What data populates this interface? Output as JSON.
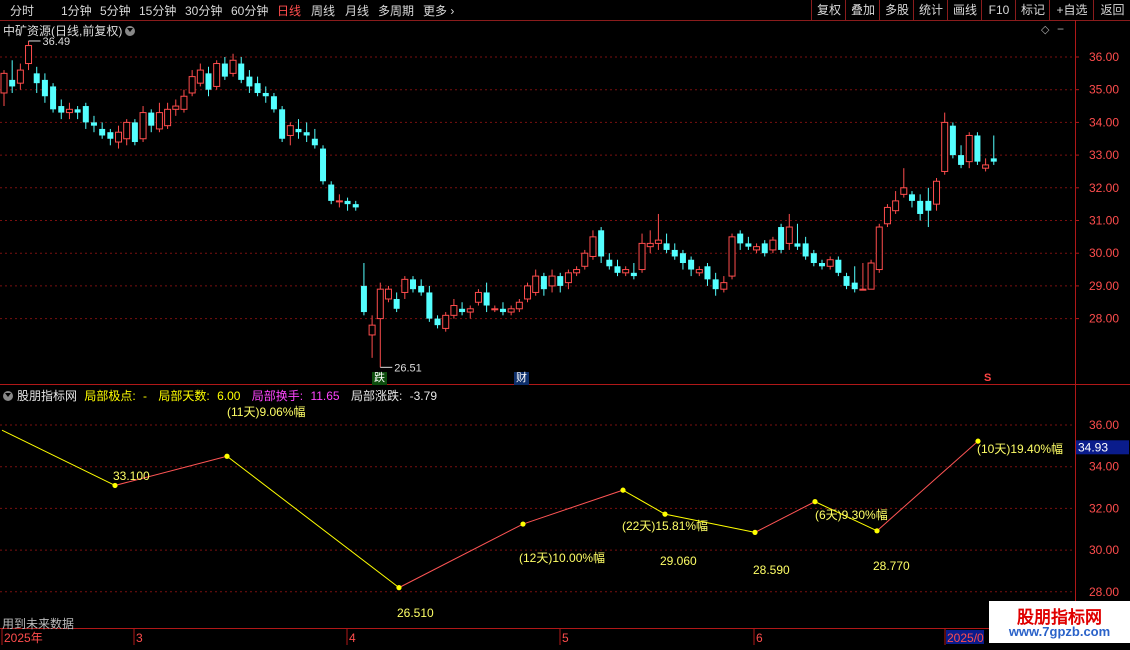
{
  "toolbar": {
    "timeframes": [
      "分时",
      "1分钟",
      "5分钟",
      "15分钟",
      "30分钟",
      "60分钟",
      "日线",
      "周线",
      "月线",
      "多周期",
      "更多"
    ],
    "active_index": 6,
    "buttons": [
      "复权",
      "叠加",
      "多股",
      "统计",
      "画线",
      "F10",
      "标记",
      "+自选",
      "返回"
    ]
  },
  "chart_title": "中矿资源(日线,前复权)",
  "colors": {
    "up": "#ff4d4d",
    "down": "#54ffff",
    "line": "#ffff00",
    "grid": "#7a1010",
    "axis": "#b01818"
  },
  "main_axis_labels": [
    "36.00",
    "35.00",
    "34.00",
    "33.00",
    "32.00",
    "31.00",
    "30.00",
    "29.00",
    "28.00"
  ],
  "high_label": "36.49",
  "low_label": "26.51",
  "event_marks": [
    "跌",
    "财",
    "S"
  ],
  "indicator": {
    "name": "股朋指标网",
    "items": [
      {
        "label": "局部极点:",
        "value": "-",
        "color": "#ffff00"
      },
      {
        "label": "局部天数:",
        "value": "6.00",
        "color": "#ffff00"
      },
      {
        "label": "局部换手:",
        "value": "11.65",
        "color": "#ff44ff"
      },
      {
        "label": "局部涨跌:",
        "value": "-3.79",
        "color": "#e6e6e6"
      }
    ],
    "axis_labels": [
      "36.00",
      "34.00",
      "32.00",
      "30.00",
      "28.00"
    ],
    "current_value": "34.93",
    "labels": [
      "33.100",
      "(11天)9.06%幅",
      "26.510",
      "(12天)10.00%幅",
      "(22天)15.81%幅",
      "29.060",
      "28.590",
      "(6天)9.30%幅",
      "28.770",
      "(10天)19.40%幅"
    ]
  },
  "footer_text": "用到未来数据",
  "date_axis": [
    "2025年",
    "3",
    "4",
    "5",
    "6",
    "2025/0"
  ],
  "watermark": {
    "line1": "股朋指标网",
    "line2": "www.7gpzb.com"
  },
  "candles": [
    [
      34.9,
      35.5,
      35.6,
      34.5
    ],
    [
      35.3,
      35.1,
      35.9,
      34.9
    ],
    [
      35.2,
      35.6,
      35.8,
      35.0
    ],
    [
      35.8,
      36.35,
      36.49,
      35.6
    ],
    [
      35.5,
      35.2,
      35.7,
      34.9
    ],
    [
      35.3,
      34.8,
      35.5,
      34.6
    ],
    [
      35.1,
      34.4,
      35.2,
      34.3
    ],
    [
      34.5,
      34.3,
      34.7,
      34.1
    ],
    [
      34.3,
      34.4,
      34.6,
      34.1
    ],
    [
      34.4,
      34.3,
      34.5,
      34.1
    ],
    [
      34.5,
      34.0,
      34.6,
      33.8
    ],
    [
      34.0,
      33.9,
      34.2,
      33.7
    ],
    [
      33.8,
      33.6,
      34.0,
      33.5
    ],
    [
      33.7,
      33.5,
      33.8,
      33.3
    ],
    [
      33.4,
      33.7,
      33.9,
      33.2
    ],
    [
      33.5,
      34.0,
      34.1,
      33.3
    ],
    [
      34.0,
      33.4,
      34.1,
      33.3
    ],
    [
      33.5,
      34.3,
      34.5,
      33.4
    ],
    [
      34.3,
      33.9,
      34.4,
      33.7
    ],
    [
      33.8,
      34.3,
      34.6,
      33.7
    ],
    [
      33.9,
      34.4,
      34.6,
      33.8
    ],
    [
      34.4,
      34.5,
      34.7,
      34.2
    ],
    [
      34.4,
      34.8,
      35.0,
      34.3
    ],
    [
      34.9,
      35.4,
      35.6,
      34.8
    ],
    [
      35.2,
      35.6,
      35.8,
      35.1
    ],
    [
      35.5,
      35.0,
      35.7,
      34.8
    ],
    [
      35.1,
      35.8,
      35.9,
      35.0
    ],
    [
      35.8,
      35.4,
      36.0,
      35.3
    ],
    [
      35.5,
      35.9,
      36.1,
      35.4
    ],
    [
      35.8,
      35.3,
      36.0,
      35.2
    ],
    [
      35.4,
      35.1,
      35.6,
      34.9
    ],
    [
      35.2,
      34.9,
      35.4,
      34.8
    ],
    [
      34.9,
      34.8,
      35.1,
      34.6
    ],
    [
      34.8,
      34.4,
      34.9,
      34.3
    ],
    [
      34.4,
      33.5,
      34.5,
      33.4
    ],
    [
      33.6,
      33.9,
      34.0,
      33.3
    ],
    [
      33.8,
      33.7,
      34.1,
      33.5
    ],
    [
      33.7,
      33.6,
      34.0,
      33.4
    ],
    [
      33.5,
      33.3,
      33.8,
      33.2
    ],
    [
      33.2,
      32.2,
      33.3,
      32.1
    ],
    [
      32.1,
      31.6,
      32.2,
      31.5
    ],
    [
      31.6,
      31.6,
      31.8,
      31.4
    ],
    [
      31.6,
      31.5,
      31.7,
      31.3
    ],
    [
      31.5,
      31.4,
      31.6,
      31.3
    ],
    [
      29.0,
      28.2,
      29.7,
      28.1
    ],
    [
      27.5,
      27.8,
      28.1,
      26.8
    ],
    [
      28.0,
      28.9,
      29.1,
      26.51
    ],
    [
      28.6,
      28.9,
      29.0,
      28.5
    ],
    [
      28.6,
      28.3,
      28.8,
      28.2
    ],
    [
      28.8,
      29.2,
      29.3,
      28.6
    ],
    [
      29.2,
      28.9,
      29.3,
      28.8
    ],
    [
      29.0,
      28.8,
      29.2,
      28.7
    ],
    [
      28.8,
      28.0,
      29.0,
      27.9
    ],
    [
      28.0,
      27.8,
      28.1,
      27.7
    ],
    [
      27.7,
      28.1,
      28.2,
      27.6
    ],
    [
      28.1,
      28.4,
      28.6,
      28.0
    ],
    [
      28.3,
      28.2,
      28.5,
      28.1
    ],
    [
      28.2,
      28.3,
      28.4,
      28.0
    ],
    [
      28.5,
      28.8,
      28.9,
      28.4
    ],
    [
      28.8,
      28.4,
      29.1,
      28.2
    ],
    [
      28.3,
      28.3,
      28.4,
      28.2
    ],
    [
      28.3,
      28.2,
      28.5,
      28.1
    ],
    [
      28.2,
      28.3,
      28.4,
      28.1
    ],
    [
      28.3,
      28.5,
      28.6,
      28.2
    ],
    [
      28.6,
      29.0,
      29.1,
      28.5
    ],
    [
      28.8,
      29.3,
      29.5,
      28.7
    ],
    [
      29.3,
      28.9,
      29.4,
      28.7
    ],
    [
      29.0,
      29.3,
      29.5,
      28.8
    ],
    [
      29.3,
      29.0,
      29.4,
      28.8
    ],
    [
      29.1,
      29.4,
      29.5,
      28.9
    ],
    [
      29.4,
      29.5,
      29.6,
      29.3
    ],
    [
      29.6,
      30.0,
      30.1,
      29.5
    ],
    [
      29.9,
      30.5,
      30.7,
      29.8
    ],
    [
      30.7,
      29.9,
      30.8,
      29.7
    ],
    [
      29.8,
      29.6,
      30.0,
      29.5
    ],
    [
      29.6,
      29.4,
      29.8,
      29.3
    ],
    [
      29.4,
      29.5,
      29.6,
      29.3
    ],
    [
      29.4,
      29.3,
      29.7,
      29.2
    ],
    [
      29.5,
      30.3,
      30.6,
      29.4
    ],
    [
      30.2,
      30.3,
      30.7,
      30.0
    ],
    [
      30.3,
      30.4,
      31.2,
      30.1
    ],
    [
      30.3,
      30.1,
      30.6,
      30.0
    ],
    [
      30.1,
      29.9,
      30.3,
      29.8
    ],
    [
      30.0,
      29.7,
      30.1,
      29.5
    ],
    [
      29.8,
      29.5,
      29.9,
      29.3
    ],
    [
      29.4,
      29.5,
      29.6,
      29.3
    ],
    [
      29.6,
      29.2,
      29.7,
      29.0
    ],
    [
      29.2,
      28.9,
      29.4,
      28.7
    ],
    [
      28.9,
      29.1,
      29.3,
      28.8
    ],
    [
      29.3,
      30.5,
      30.6,
      29.2
    ],
    [
      30.6,
      30.3,
      30.7,
      30.1
    ],
    [
      30.3,
      30.2,
      30.5,
      30.1
    ],
    [
      30.1,
      30.2,
      30.3,
      30.0
    ],
    [
      30.3,
      30.0,
      30.4,
      29.9
    ],
    [
      30.1,
      30.4,
      30.5,
      30.0
    ],
    [
      30.8,
      30.1,
      30.9,
      30.0
    ],
    [
      30.3,
      30.8,
      31.2,
      30.1
    ],
    [
      30.3,
      30.2,
      30.9,
      30.1
    ],
    [
      30.3,
      29.9,
      30.5,
      29.8
    ],
    [
      30.0,
      29.7,
      30.1,
      29.6
    ],
    [
      29.7,
      29.6,
      29.8,
      29.5
    ],
    [
      29.6,
      29.8,
      29.9,
      29.5
    ],
    [
      29.8,
      29.4,
      29.9,
      29.3
    ],
    [
      29.3,
      29.0,
      29.4,
      28.9
    ],
    [
      29.1,
      28.9,
      29.6,
      28.8
    ],
    [
      28.9,
      28.9,
      29.7,
      28.9
    ],
    [
      28.9,
      29.7,
      29.8,
      28.9
    ],
    [
      29.5,
      30.8,
      30.9,
      29.4
    ],
    [
      30.9,
      31.4,
      31.5,
      30.8
    ],
    [
      31.3,
      31.6,
      31.9,
      31.2
    ],
    [
      31.8,
      32.0,
      32.6,
      31.7
    ],
    [
      31.8,
      31.6,
      31.9,
      31.4
    ],
    [
      31.6,
      31.2,
      31.8,
      31.0
    ],
    [
      31.6,
      31.3,
      32.0,
      30.8
    ],
    [
      31.5,
      32.2,
      32.3,
      31.3
    ],
    [
      32.5,
      34.0,
      34.3,
      32.4
    ],
    [
      33.9,
      33.0,
      34.0,
      32.9
    ],
    [
      33.0,
      32.7,
      33.3,
      32.6
    ],
    [
      32.8,
      33.6,
      33.7,
      32.6
    ],
    [
      33.6,
      32.8,
      33.7,
      32.7
    ],
    [
      32.6,
      32.7,
      32.9,
      32.5
    ],
    [
      32.9,
      32.8,
      33.6,
      32.7
    ]
  ],
  "line_points": [
    [
      33.0,
      2
    ],
    [
      27.7,
      115
    ],
    [
      30.5,
      227
    ],
    [
      17.9,
      399
    ],
    [
      24.0,
      523
    ],
    [
      27.25,
      623
    ],
    [
      24.95,
      665
    ],
    [
      23.2,
      755
    ],
    [
      26.15,
      815
    ],
    [
      23.35,
      877
    ],
    [
      31.95,
      978
    ]
  ]
}
